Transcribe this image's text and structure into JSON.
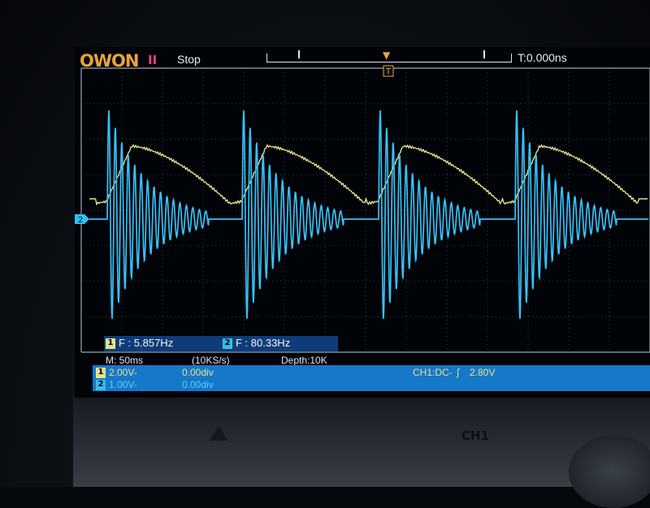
{
  "header": {
    "logo_text": "OWON",
    "run_icon": "pause-icon",
    "run_state": "Stop",
    "trigger_time": "T:0.000ns"
  },
  "markers": {
    "trigger_marker": "T",
    "ch2_marker": "2"
  },
  "measurements": {
    "ch1": {
      "label": "1",
      "text": "F : 5.857Hz"
    },
    "ch2": {
      "label": "2",
      "text": "F : 80.33Hz"
    }
  },
  "status": {
    "timebase": "M: 50ms",
    "sample_rate": "(10KS/s)",
    "depth": "Depth:10K"
  },
  "channels": [
    {
      "num": "1",
      "scale": "2.00V-",
      "offset": "0.00div",
      "color": "#e8e08a"
    },
    {
      "num": "2",
      "scale": "1.00V-",
      "offset": "0.00div",
      "color": "#33bdf2"
    }
  ],
  "trigger": {
    "coupling": "CH1:DC-",
    "edge_icon": "rising-edge-icon",
    "level": "2.80V"
  },
  "panel": {
    "ch1_label": "CH1"
  },
  "waveform_display": {
    "type": "line",
    "grid": true,
    "x_divisions": 14,
    "y_divisions": 8,
    "series": [
      {
        "channel": "1",
        "color": "#e3df8a",
        "frequency_hz": 5.857
      },
      {
        "channel": "2",
        "color": "#37c0f5",
        "frequency_hz": 80.33
      }
    ]
  }
}
